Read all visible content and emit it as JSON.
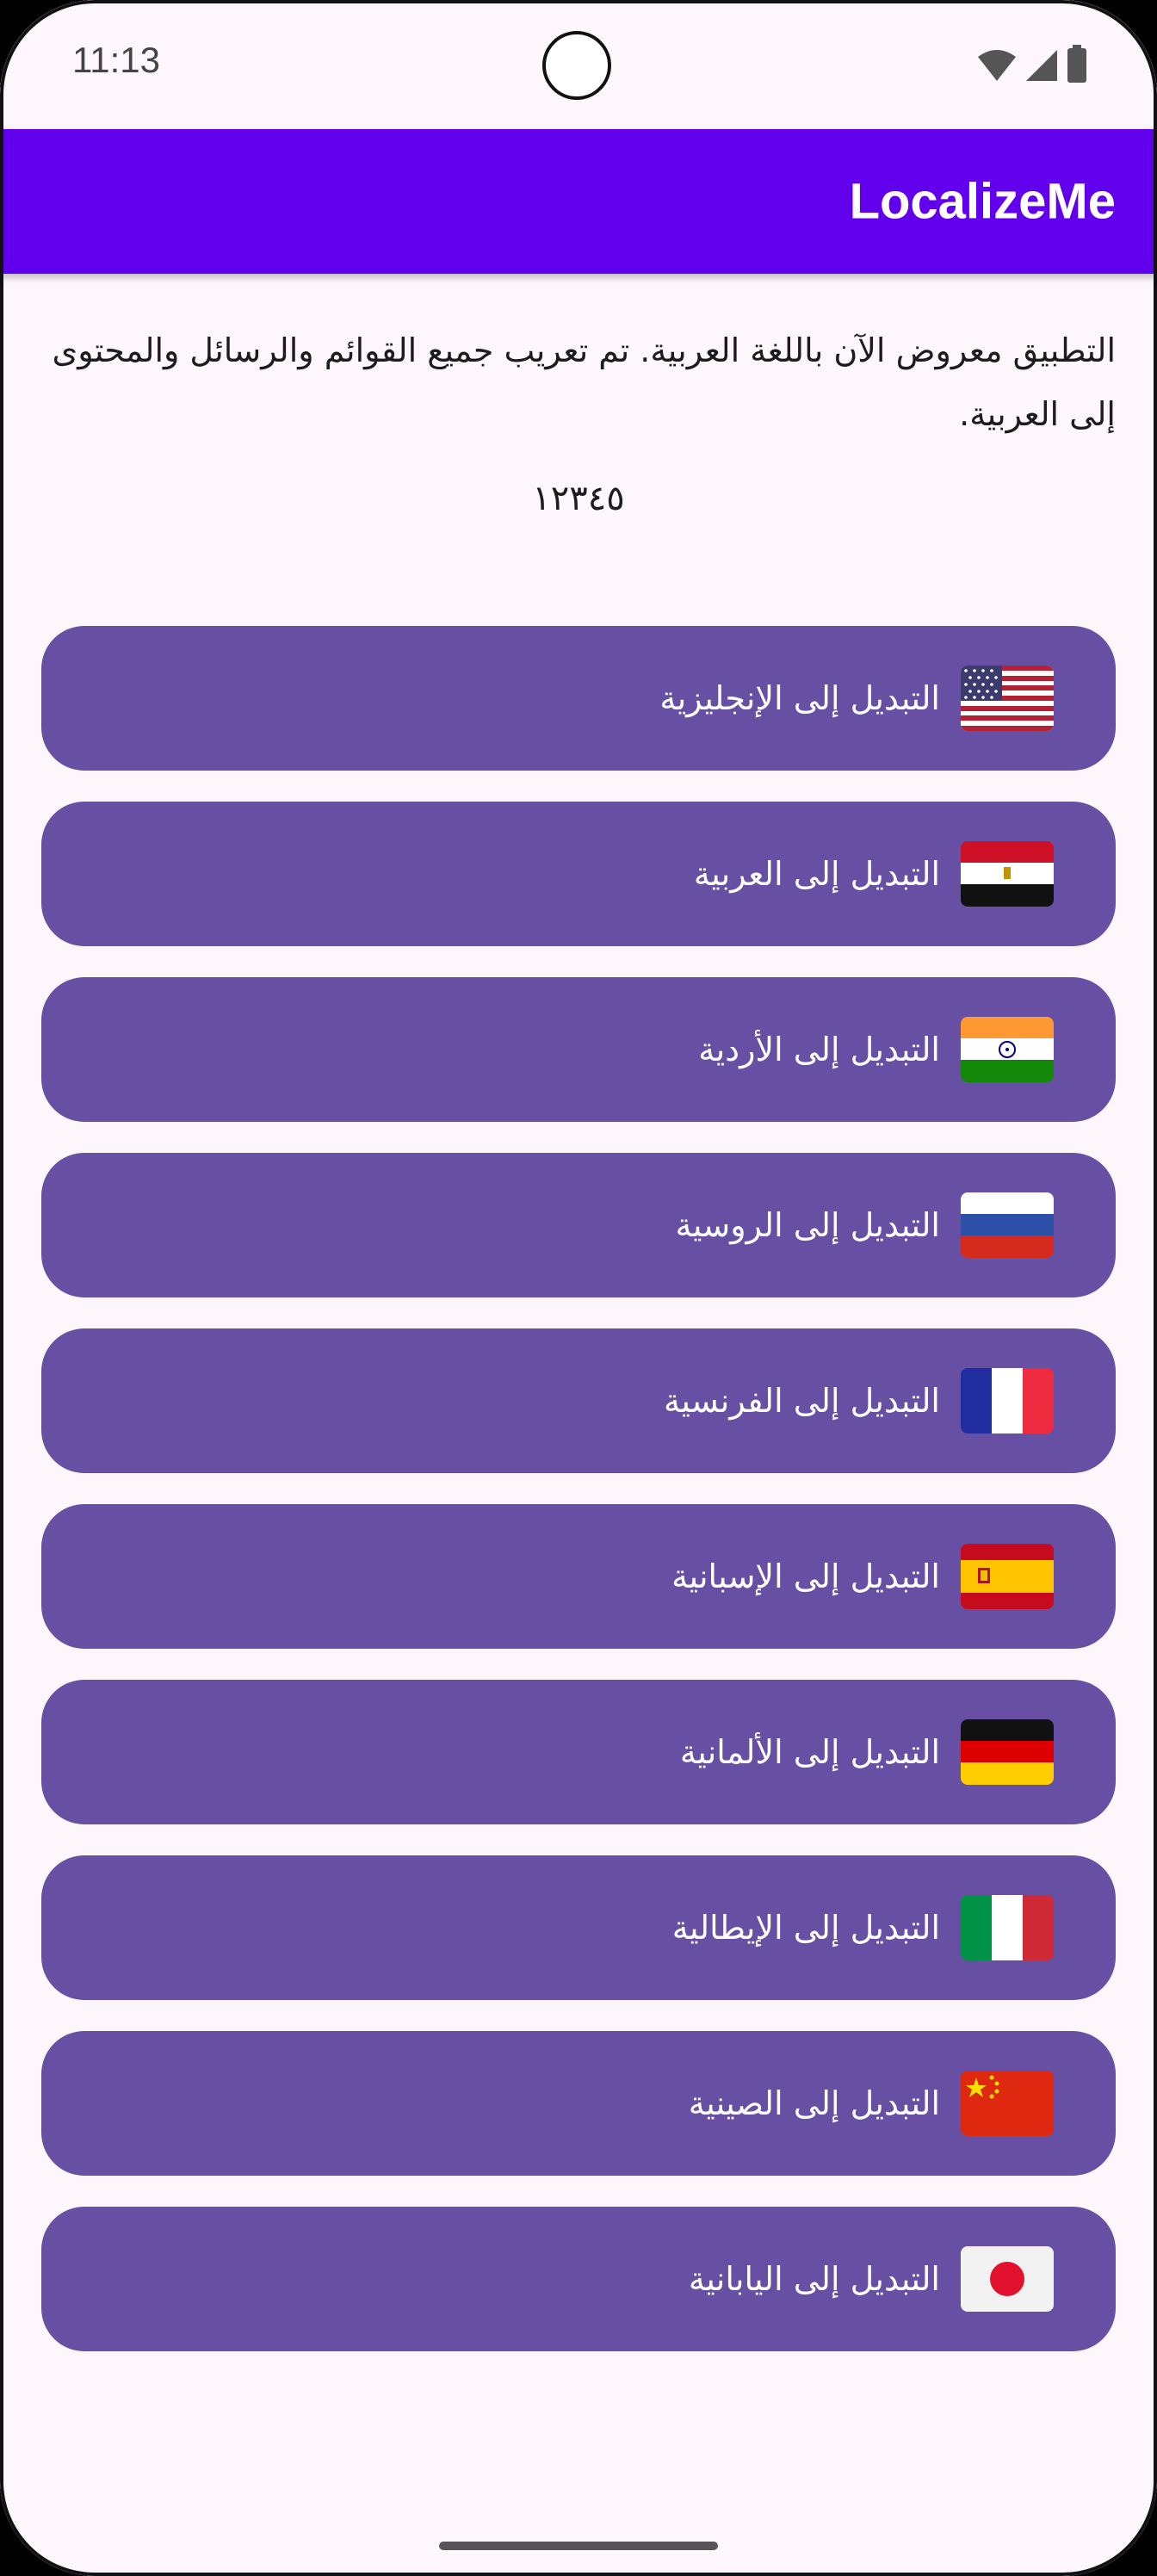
{
  "status_bar": {
    "time": "11:13",
    "icons": [
      "wifi-icon",
      "cellular-signal-icon",
      "battery-icon"
    ]
  },
  "app_bar": {
    "title": "LocalizeMe",
    "color": "#6200EE"
  },
  "main": {
    "description": "التطبيق معروض الآن باللغة العربية. تم تعريب جميع القوائم والرسائل والمحتوى إلى العربية.",
    "numbers": "١٢٣٤٥"
  },
  "buttons": [
    {
      "label": "التبديل إلى الإنجليزية",
      "flag": "usa-flag-icon"
    },
    {
      "label": "التبديل إلى العربية",
      "flag": "egypt-flag-icon"
    },
    {
      "label": "التبديل إلى الأردية",
      "flag": "india-flag-icon"
    },
    {
      "label": "التبديل إلى الروسية",
      "flag": "russia-flag-icon"
    },
    {
      "label": "التبديل إلى الفرنسية",
      "flag": "france-flag-icon"
    },
    {
      "label": "التبديل إلى الإسبانية",
      "flag": "spain-flag-icon"
    },
    {
      "label": "التبديل إلى الألمانية",
      "flag": "germany-flag-icon"
    },
    {
      "label": "التبديل إلى الإيطالية",
      "flag": "italy-flag-icon"
    },
    {
      "label": "التبديل إلى الصينية",
      "flag": "china-flag-icon"
    },
    {
      "label": "التبديل إلى اليابانية",
      "flag": "japan-flag-icon"
    }
  ],
  "colors": {
    "button": "#6750A4",
    "background": "#FDF7FC"
  }
}
